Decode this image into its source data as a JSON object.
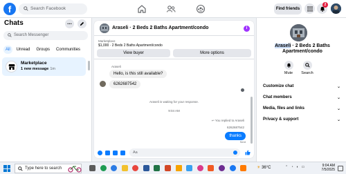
{
  "topbar": {
    "logo": "f",
    "search_placeholder": "Search Facebook",
    "find_friends": "Find friends",
    "notification_count": "2"
  },
  "left": {
    "title": "Chats",
    "more_glyph": "...",
    "search_placeholder": "Search Messenger",
    "tabs": [
      {
        "label": "All",
        "active": true
      },
      {
        "label": "Unread",
        "active": false
      },
      {
        "label": "Groups",
        "active": false
      },
      {
        "label": "Communities",
        "active": false
      }
    ],
    "conversation": {
      "name": "Marketplace",
      "subtitle": "1 new message",
      "time": "1m"
    }
  },
  "chat": {
    "title": "Araseli · 2 Beds 2 Baths Apartment/condo",
    "info_glyph": "i",
    "listing_label": "Marketplace",
    "listing_detail": "$1,000 · 2 Beds 2 Baths Apartment/condo",
    "view_buyer": "View buyer",
    "more_options": "More options",
    "sender": "Araseli",
    "messages_in": [
      "Hello, is this still available?",
      "6262687542"
    ],
    "waiting_text": "Araseli is waiting for your response.",
    "time_divider": "9:04 AM",
    "replied_text": "You replied to Araseli",
    "quoted_text": "6262687542",
    "message_out": "thanks",
    "sent_label": "Sent",
    "compose_placeholder": "Aa"
  },
  "right": {
    "name_highlight": "Araseli",
    "name_rest": " · 2 Beds 2 Baths Apartment/condo",
    "actions": [
      {
        "label": "Mute",
        "icon": "bell-icon"
      },
      {
        "label": "Search",
        "icon": "search-icon"
      }
    ],
    "sections": [
      "Customize chat",
      "Chat members",
      "Media, files and links",
      "Privacy & support"
    ]
  },
  "taskbar": {
    "search_placeholder": "Type here to search",
    "weather": "36°C",
    "clock_time": "9:04 AM",
    "clock_date": "7/5/2025"
  },
  "colors": {
    "brand": "#1877f2",
    "messenger_blue": "#0a7cff",
    "badge_red": "#e41e3f"
  }
}
